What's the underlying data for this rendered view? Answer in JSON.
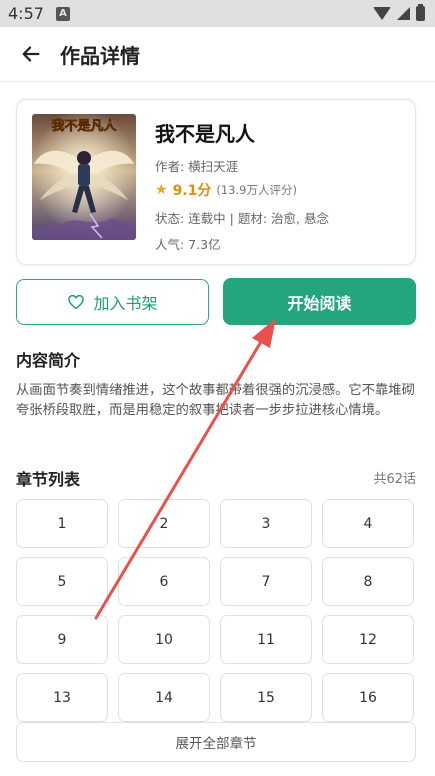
{
  "status_bar": {
    "time": "4:57",
    "notification_badge": "A"
  },
  "app_bar": {
    "title": "作品详情",
    "back_icon": "arrow-left-icon"
  },
  "book": {
    "title": "我不是凡人",
    "author": "作者: 横扫天涯",
    "score": "9.1分",
    "raters": "(13.9万人评分)",
    "status_line": "状态: 连载中 | 题材: 治愈, 悬念",
    "popularity": "人气: 7.3亿",
    "cover_text": "我不是凡人"
  },
  "actions": {
    "add_shelf_label": "加入书架",
    "start_read_label": "开始阅读"
  },
  "intro": {
    "heading": "内容简介",
    "text": "从画面节奏到情绪推进，这个故事都带着很强的沉浸感。它不靠堆砌夸张桥段取胜，而是用稳定的叙事把读者一步步拉进核心情境。"
  },
  "chapters": {
    "heading": "章节列表",
    "count": "共62话",
    "items": [
      "1",
      "2",
      "3",
      "4",
      "5",
      "6",
      "7",
      "8",
      "9",
      "10",
      "11",
      "12",
      "13",
      "14",
      "15",
      "16"
    ],
    "expand_label": "展开全部章节"
  },
  "colors": {
    "accent": "#23a57e",
    "star": "#f2a31c",
    "annotation_arrow": "#e8514c"
  }
}
